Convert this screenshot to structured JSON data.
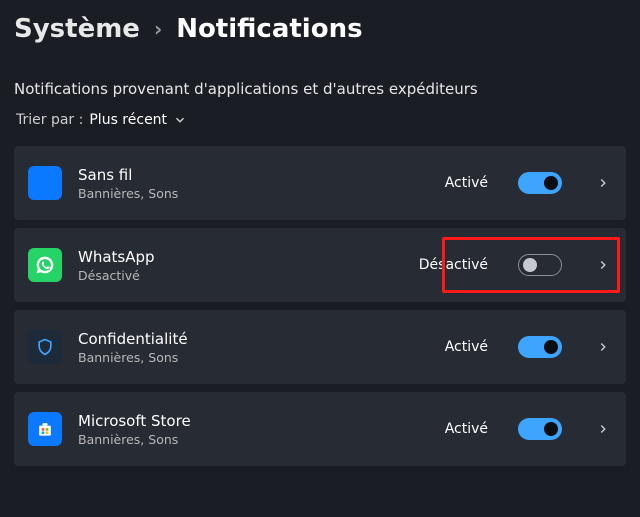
{
  "breadcrumb": {
    "prev": "Système",
    "sep": "›",
    "current": "Notifications"
  },
  "subheading": "Notifications provenant d'applications et d'autres expéditeurs",
  "sort": {
    "label_prefix": "Trier par :",
    "value": "Plus récent"
  },
  "status_labels": {
    "on": "Activé",
    "off": "Désactivé"
  },
  "apps": [
    {
      "name": "Sans fil",
      "sub": "Bannières, Sons",
      "enabled": true,
      "icon": "wifi"
    },
    {
      "name": "WhatsApp",
      "sub": "Désactivé",
      "enabled": false,
      "icon": "whatsapp",
      "highlighted": true
    },
    {
      "name": "Confidentialité",
      "sub": "Bannières, Sons",
      "enabled": true,
      "icon": "privacy"
    },
    {
      "name": "Microsoft Store",
      "sub": "Bannières, Sons",
      "enabled": true,
      "icon": "store"
    }
  ]
}
